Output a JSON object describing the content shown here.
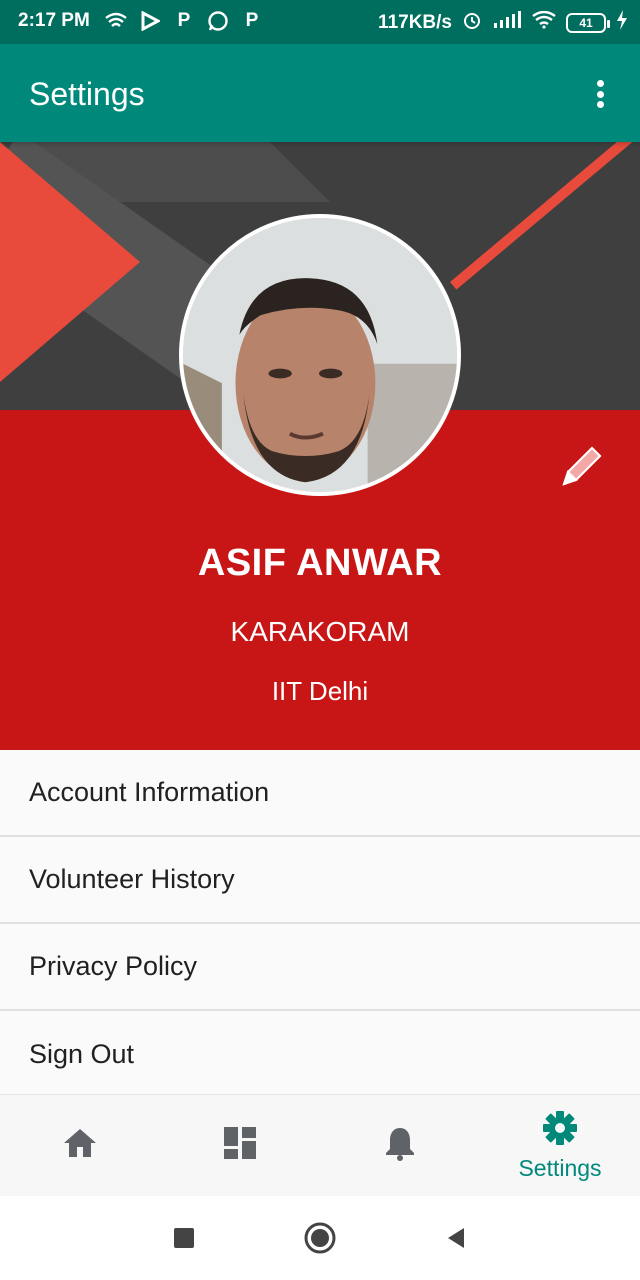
{
  "status_bar": {
    "time": "2:17 PM",
    "network_speed": "117KB/s",
    "battery_level": "41",
    "icons_left": [
      "wifi-signal-icon",
      "play-store-icon",
      "paytm-icon",
      "whatsapp-icon",
      "paytm-icon"
    ],
    "icons_right": [
      "alarm-icon",
      "cellular-signal-icon",
      "wifi-icon",
      "battery-icon",
      "charging-icon"
    ]
  },
  "app_bar": {
    "title": "Settings",
    "overflow_icon": "more-vert-icon"
  },
  "profile": {
    "name": "ASIF ANWAR",
    "hostel": "KARAKORAM",
    "institute": "IIT Delhi",
    "edit_icon": "pencil-icon"
  },
  "settings_items": [
    {
      "label": "Account Information"
    },
    {
      "label": "Volunteer History"
    },
    {
      "label": "Privacy Policy"
    },
    {
      "label": "Sign Out"
    }
  ],
  "bottom_nav": {
    "items": [
      {
        "icon": "home-icon",
        "label": ""
      },
      {
        "icon": "dashboard-icon",
        "label": ""
      },
      {
        "icon": "notifications-icon",
        "label": ""
      },
      {
        "icon": "settings-gear-icon",
        "label": "Settings",
        "active": true
      }
    ]
  },
  "system_nav": [
    "recents-icon",
    "home-circle-icon",
    "back-icon"
  ],
  "colors": {
    "primary": "#00897b",
    "primary_dark": "#006e5e",
    "header_red": "#c81515",
    "accent_red": "#e84b3c",
    "header_gray": "#3f3f3f"
  }
}
